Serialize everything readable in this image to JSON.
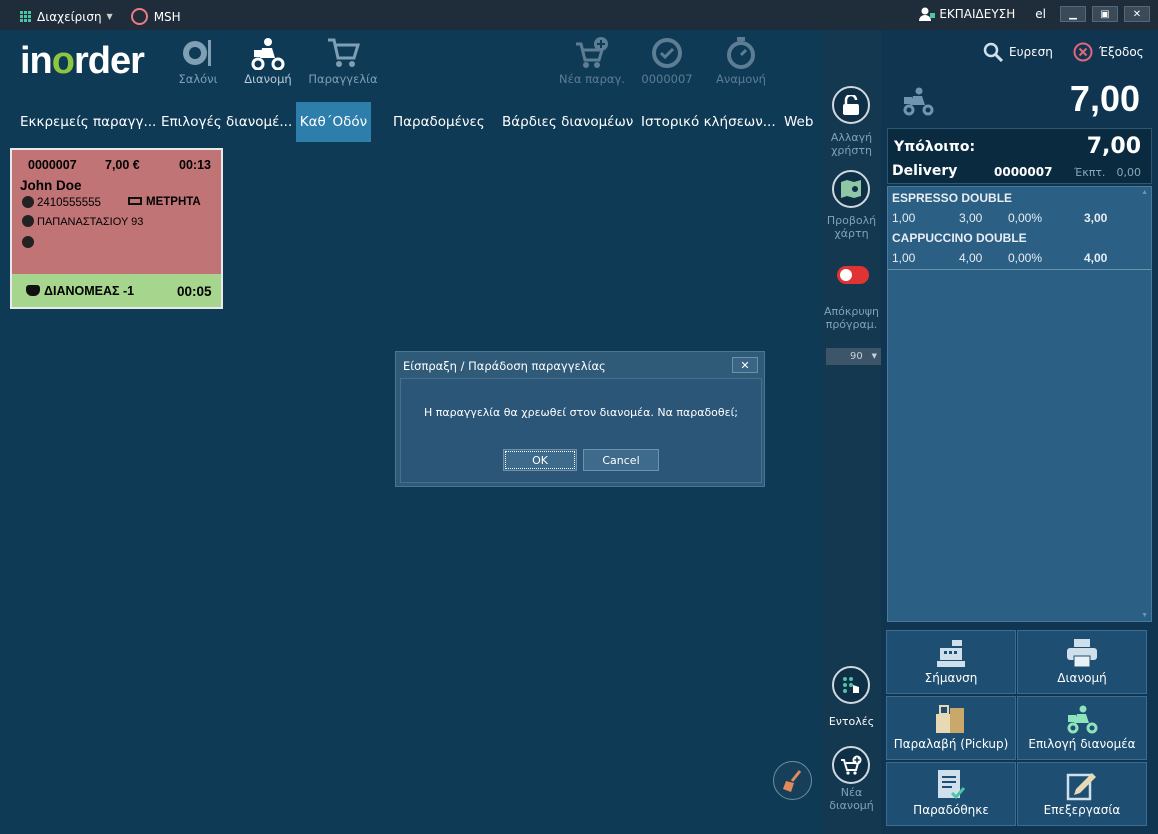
{
  "titlebar": {
    "menu_label": "Διαχείριση",
    "station": "MSH",
    "user": "ΕΚΠΑΙΔΕΥΣΗ",
    "language": "el"
  },
  "toolbar": {
    "salon": "Σαλόνι",
    "delivery": "Διανομή",
    "order": "Παραγγελία",
    "new_order": "Νέα παραγ.",
    "order_number": "0000007",
    "waiting": "Αναμονή"
  },
  "tabs": [
    {
      "label": "Εκκρεμείς παραγγ..."
    },
    {
      "label": "Επιλογές διανομέ..."
    },
    {
      "label": "Καθ΄Οδόν"
    },
    {
      "label": "Παραδομένες"
    },
    {
      "label": "Βάρδιες διανομέων"
    },
    {
      "label": "Ιστορικό κλήσεων..."
    },
    {
      "label": "Web"
    }
  ],
  "order_card": {
    "order_no": "0000007",
    "amount": "7,00 €",
    "time": "00:13",
    "customer": "John Doe",
    "phone": "2410555555",
    "payment": "ΜΕΤΡΗΤΑ",
    "address": "ΠΑΠΑΝΑΣΤΑΣΙΟΥ 93",
    "driver": "ΔΙΑΝΟΜΕΑΣ -1",
    "driver_time": "00:05"
  },
  "dialog": {
    "title": "Είσπραξη / Παράδοση παραγγελίας",
    "message": "Η παραγγελία θα χρεωθεί στον διανομέα. Να παραδοθεί;",
    "ok": "OK",
    "cancel": "Cancel"
  },
  "strip": {
    "change_user": [
      "Αλλαγή",
      "χρήστη"
    ],
    "map_view": [
      "Προβολή",
      "χάρτη"
    ],
    "hide_program": [
      "Απόκρυψη",
      "πρόγραμ."
    ],
    "select_value": "90",
    "commands": "Εντολές",
    "new_delivery": [
      "Νέα",
      "διανομή"
    ]
  },
  "right_panel": {
    "search": "Ευρεση",
    "exit": "Έξοδος",
    "total": "7,00",
    "remaining_label": "Υπόλοιπο:",
    "remaining_value": "7,00",
    "type": "Delivery",
    "order_no": "0000007",
    "discount_label": "Έκπτ.",
    "discount_value": "0,00",
    "items": [
      {
        "name": "ESPRESSO DOUBLE",
        "qty": "1,00",
        "price": "3,00",
        "disc": "0,00%",
        "total": "3,00"
      },
      {
        "name": "CAPPUCCINO DOUBLE",
        "qty": "1,00",
        "price": "4,00",
        "disc": "0,00%",
        "total": "4,00"
      }
    ],
    "actions": {
      "mark": "Σήμανση",
      "delivery": "Διανομή",
      "pickup": "Παραλαβή (Pickup)",
      "select_driver": "Επιλογή διανομέα",
      "delivered": "Παραδόθηκε",
      "edit": "Επεξεργασία"
    }
  },
  "colors": {
    "background": "#0f3a55",
    "active_tab": "#2e7eab",
    "card_red": "#c07476",
    "card_green": "#a6d58e",
    "toggle_red": "#e03333",
    "logo_accent": "#8ec63f"
  }
}
